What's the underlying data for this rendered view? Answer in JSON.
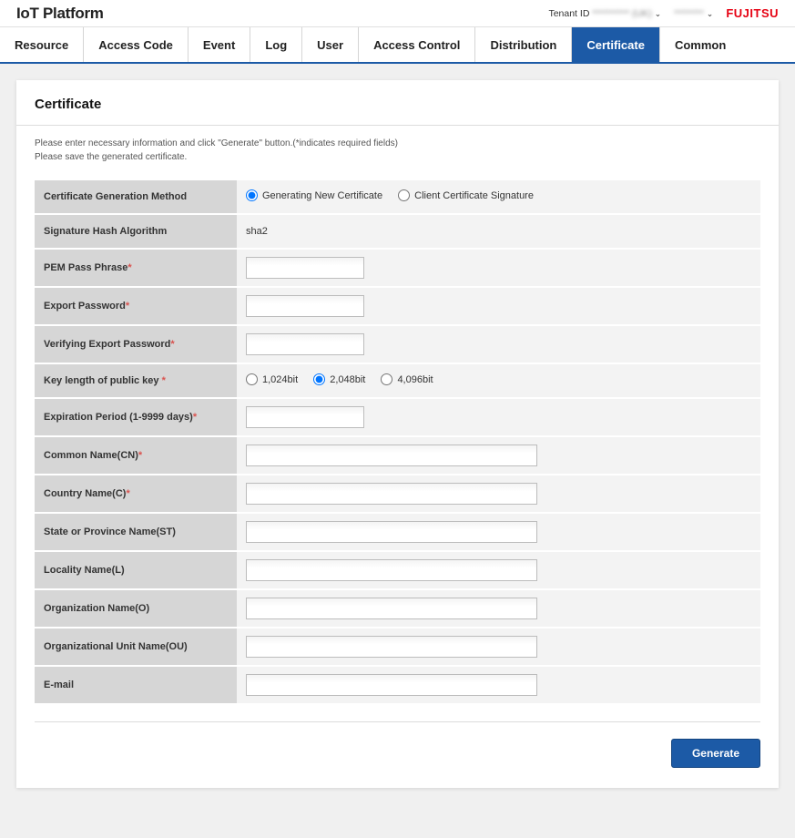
{
  "app": {
    "title": "IoT Platform"
  },
  "header": {
    "tenant_label": "Tenant ID",
    "tenant_value": "********** (UK)",
    "user_value": "********",
    "brand": "FUJITSU"
  },
  "tabs": [
    {
      "label": "Resource",
      "active": false
    },
    {
      "label": "Access Code",
      "active": false
    },
    {
      "label": "Event",
      "active": false
    },
    {
      "label": "Log",
      "active": false
    },
    {
      "label": "User",
      "active": false
    },
    {
      "label": "Access Control",
      "active": false
    },
    {
      "label": "Distribution",
      "active": false
    },
    {
      "label": "Certificate",
      "active": true
    },
    {
      "label": "Common",
      "active": false
    }
  ],
  "page": {
    "title": "Certificate",
    "helper1": "Please enter necessary information and click \"Generate\" button.(*indicates required fields)",
    "helper2": "Please save the generated certificate."
  },
  "form": {
    "method_label": "Certificate Generation Method",
    "method_options": [
      "Generating New Certificate",
      "Client Certificate Signature"
    ],
    "method_selected": 0,
    "hash_label": "Signature Hash Algorithm",
    "hash_value": "sha2",
    "pem_label": "PEM Pass Phrase",
    "export_label": "Export Password",
    "verify_label": "Verifying Export Password",
    "keylen_label": "Key length of public key ",
    "keylen_options": [
      "1,024bit",
      "2,048bit",
      "4,096bit"
    ],
    "keylen_selected": 1,
    "expire_label": "Expiration Period (1-9999 days)",
    "cn_label": "Common Name(CN)",
    "c_label": "Country Name(C)",
    "st_label": "State or Province Name(ST)",
    "l_label": "Locality Name(L)",
    "o_label": "Organization Name(O)",
    "ou_label": "Organizational Unit Name(OU)",
    "email_label": "E-mail"
  },
  "buttons": {
    "generate": "Generate"
  }
}
